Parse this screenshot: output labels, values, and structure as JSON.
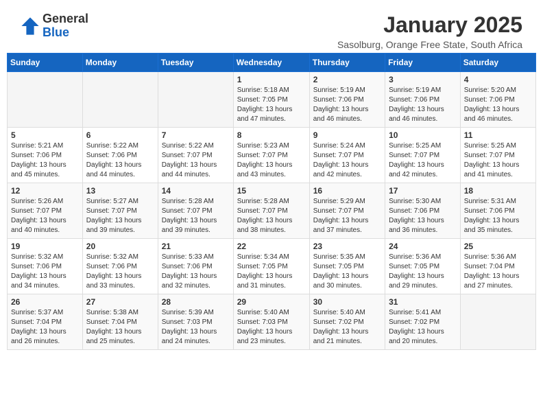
{
  "header": {
    "logo_general": "General",
    "logo_blue": "Blue",
    "title": "January 2025",
    "subtitle": "Sasolburg, Orange Free State, South Africa"
  },
  "weekdays": [
    "Sunday",
    "Monday",
    "Tuesday",
    "Wednesday",
    "Thursday",
    "Friday",
    "Saturday"
  ],
  "weeks": [
    [
      {
        "day": "",
        "info": ""
      },
      {
        "day": "",
        "info": ""
      },
      {
        "day": "",
        "info": ""
      },
      {
        "day": "1",
        "info": "Sunrise: 5:18 AM\nSunset: 7:05 PM\nDaylight: 13 hours\nand 47 minutes."
      },
      {
        "day": "2",
        "info": "Sunrise: 5:19 AM\nSunset: 7:06 PM\nDaylight: 13 hours\nand 46 minutes."
      },
      {
        "day": "3",
        "info": "Sunrise: 5:19 AM\nSunset: 7:06 PM\nDaylight: 13 hours\nand 46 minutes."
      },
      {
        "day": "4",
        "info": "Sunrise: 5:20 AM\nSunset: 7:06 PM\nDaylight: 13 hours\nand 46 minutes."
      }
    ],
    [
      {
        "day": "5",
        "info": "Sunrise: 5:21 AM\nSunset: 7:06 PM\nDaylight: 13 hours\nand 45 minutes."
      },
      {
        "day": "6",
        "info": "Sunrise: 5:22 AM\nSunset: 7:06 PM\nDaylight: 13 hours\nand 44 minutes."
      },
      {
        "day": "7",
        "info": "Sunrise: 5:22 AM\nSunset: 7:07 PM\nDaylight: 13 hours\nand 44 minutes."
      },
      {
        "day": "8",
        "info": "Sunrise: 5:23 AM\nSunset: 7:07 PM\nDaylight: 13 hours\nand 43 minutes."
      },
      {
        "day": "9",
        "info": "Sunrise: 5:24 AM\nSunset: 7:07 PM\nDaylight: 13 hours\nand 42 minutes."
      },
      {
        "day": "10",
        "info": "Sunrise: 5:25 AM\nSunset: 7:07 PM\nDaylight: 13 hours\nand 42 minutes."
      },
      {
        "day": "11",
        "info": "Sunrise: 5:25 AM\nSunset: 7:07 PM\nDaylight: 13 hours\nand 41 minutes."
      }
    ],
    [
      {
        "day": "12",
        "info": "Sunrise: 5:26 AM\nSunset: 7:07 PM\nDaylight: 13 hours\nand 40 minutes."
      },
      {
        "day": "13",
        "info": "Sunrise: 5:27 AM\nSunset: 7:07 PM\nDaylight: 13 hours\nand 39 minutes."
      },
      {
        "day": "14",
        "info": "Sunrise: 5:28 AM\nSunset: 7:07 PM\nDaylight: 13 hours\nand 39 minutes."
      },
      {
        "day": "15",
        "info": "Sunrise: 5:28 AM\nSunset: 7:07 PM\nDaylight: 13 hours\nand 38 minutes."
      },
      {
        "day": "16",
        "info": "Sunrise: 5:29 AM\nSunset: 7:07 PM\nDaylight: 13 hours\nand 37 minutes."
      },
      {
        "day": "17",
        "info": "Sunrise: 5:30 AM\nSunset: 7:06 PM\nDaylight: 13 hours\nand 36 minutes."
      },
      {
        "day": "18",
        "info": "Sunrise: 5:31 AM\nSunset: 7:06 PM\nDaylight: 13 hours\nand 35 minutes."
      }
    ],
    [
      {
        "day": "19",
        "info": "Sunrise: 5:32 AM\nSunset: 7:06 PM\nDaylight: 13 hours\nand 34 minutes."
      },
      {
        "day": "20",
        "info": "Sunrise: 5:32 AM\nSunset: 7:06 PM\nDaylight: 13 hours\nand 33 minutes."
      },
      {
        "day": "21",
        "info": "Sunrise: 5:33 AM\nSunset: 7:06 PM\nDaylight: 13 hours\nand 32 minutes."
      },
      {
        "day": "22",
        "info": "Sunrise: 5:34 AM\nSunset: 7:05 PM\nDaylight: 13 hours\nand 31 minutes."
      },
      {
        "day": "23",
        "info": "Sunrise: 5:35 AM\nSunset: 7:05 PM\nDaylight: 13 hours\nand 30 minutes."
      },
      {
        "day": "24",
        "info": "Sunrise: 5:36 AM\nSunset: 7:05 PM\nDaylight: 13 hours\nand 29 minutes."
      },
      {
        "day": "25",
        "info": "Sunrise: 5:36 AM\nSunset: 7:04 PM\nDaylight: 13 hours\nand 27 minutes."
      }
    ],
    [
      {
        "day": "26",
        "info": "Sunrise: 5:37 AM\nSunset: 7:04 PM\nDaylight: 13 hours\nand 26 minutes."
      },
      {
        "day": "27",
        "info": "Sunrise: 5:38 AM\nSunset: 7:04 PM\nDaylight: 13 hours\nand 25 minutes."
      },
      {
        "day": "28",
        "info": "Sunrise: 5:39 AM\nSunset: 7:03 PM\nDaylight: 13 hours\nand 24 minutes."
      },
      {
        "day": "29",
        "info": "Sunrise: 5:40 AM\nSunset: 7:03 PM\nDaylight: 13 hours\nand 23 minutes."
      },
      {
        "day": "30",
        "info": "Sunrise: 5:40 AM\nSunset: 7:02 PM\nDaylight: 13 hours\nand 21 minutes."
      },
      {
        "day": "31",
        "info": "Sunrise: 5:41 AM\nSunset: 7:02 PM\nDaylight: 13 hours\nand 20 minutes."
      },
      {
        "day": "",
        "info": ""
      }
    ]
  ]
}
